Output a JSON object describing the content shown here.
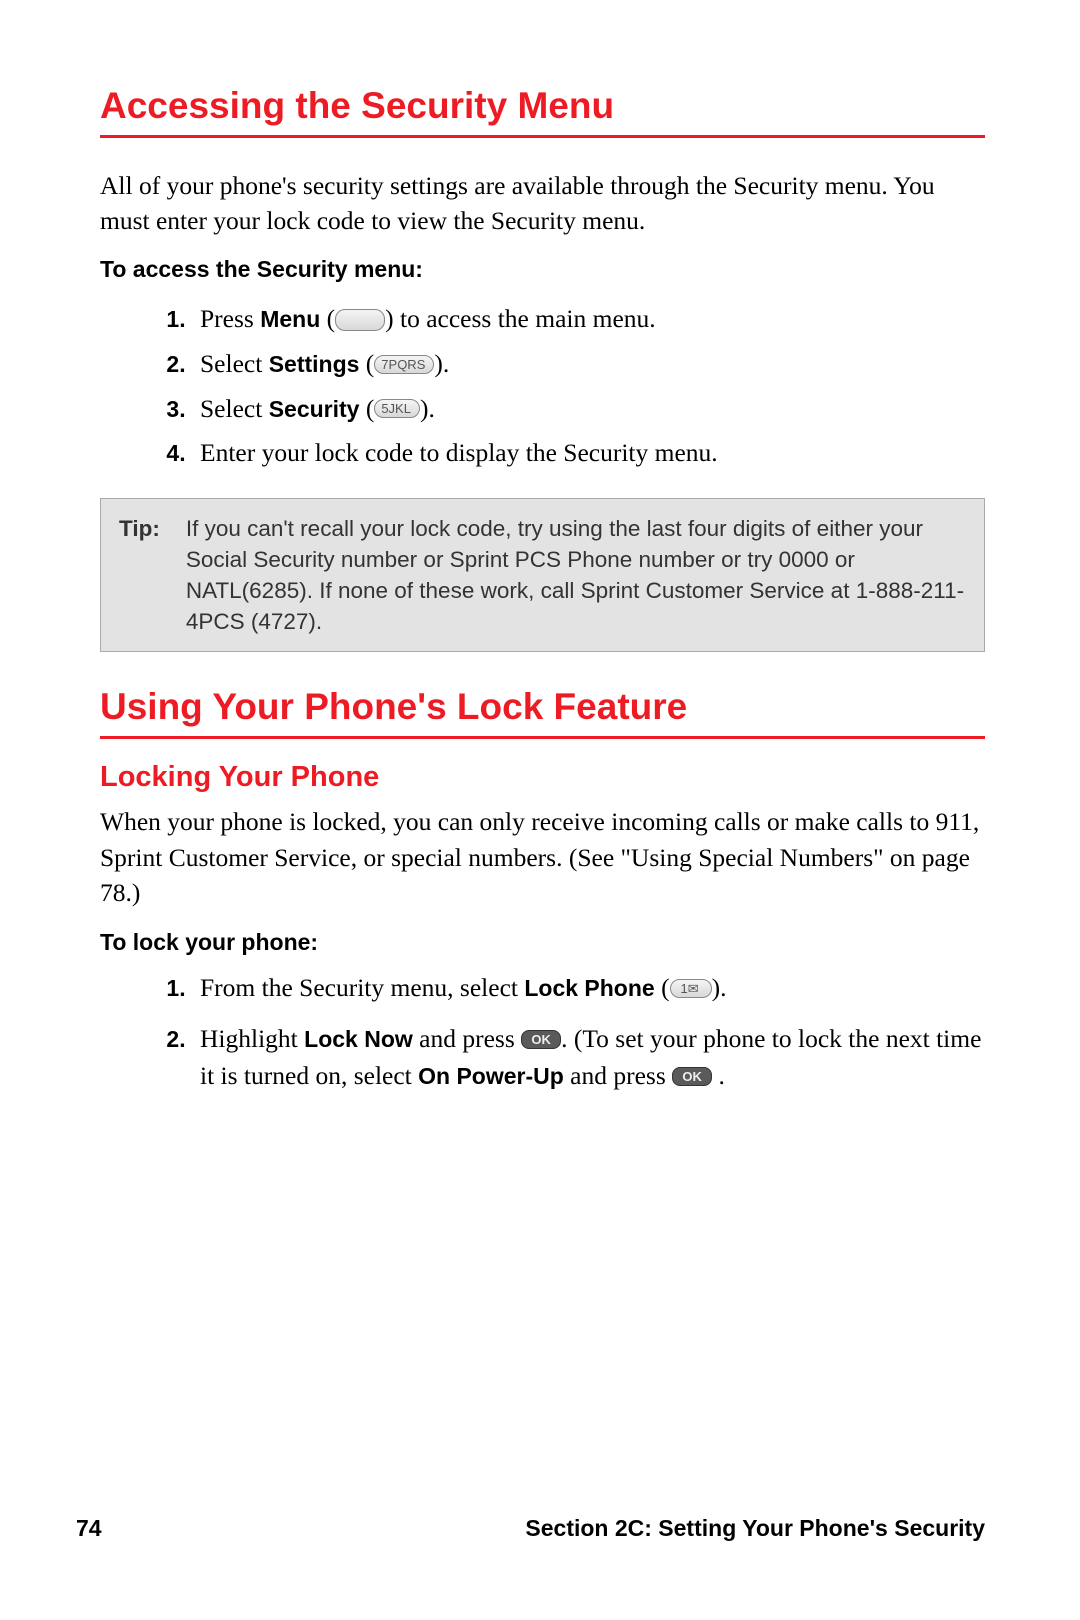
{
  "heading1": "Accessing the Security Menu",
  "intro": "All of your phone's security settings are available through the Security menu. You must enter your lock code to view the Security menu.",
  "subhead1": "To access the Security menu:",
  "steps1": {
    "s1a": "Press ",
    "s1b": "Menu",
    "s1c": " (",
    "s1key": " ",
    "s1d": ") to access the main menu.",
    "s2a": "Select ",
    "s2b": "Settings",
    "s2c": " (",
    "s2key": "7PQRS",
    "s2d": ").",
    "s3a": "Select ",
    "s3b": "Security",
    "s3c": " (",
    "s3key": "5JKL",
    "s3d": ").",
    "s4": "Enter your lock code to display the Security menu."
  },
  "tip": {
    "label": "Tip:",
    "text": "If you can't recall your lock code, try using the last four digits of either your Social Security number or Sprint PCS Phone number or try 0000 or NATL(6285). If none of these work, call Sprint Customer Service at 1-888-211-4PCS (4727)."
  },
  "heading2": "Using Your Phone's Lock Feature",
  "subheading2": "Locking Your Phone",
  "body2": "When your phone is locked, you can only receive incoming calls or make calls to 911, Sprint Customer Service, or special numbers. (See \"Using Special Numbers\" on page 78.)",
  "subhead2": "To lock your phone:",
  "steps2": {
    "s1a": "From the Security menu, select ",
    "s1b": "Lock Phone",
    "s1c": " (",
    "s1key": "1✉",
    "s1d": ").",
    "s2a": "Highlight ",
    "s2b": "Lock Now",
    "s2c": " and press ",
    "s2ok1": "OK",
    "s2d": ". (To set your phone to lock the next time it is turned on, select ",
    "s2e": "On Power-Up",
    "s2f": " and press ",
    "s2ok2": "OK",
    "s2g": " ."
  },
  "footer": {
    "page": "74",
    "section": "Section 2C: Setting Your Phone's Security"
  }
}
